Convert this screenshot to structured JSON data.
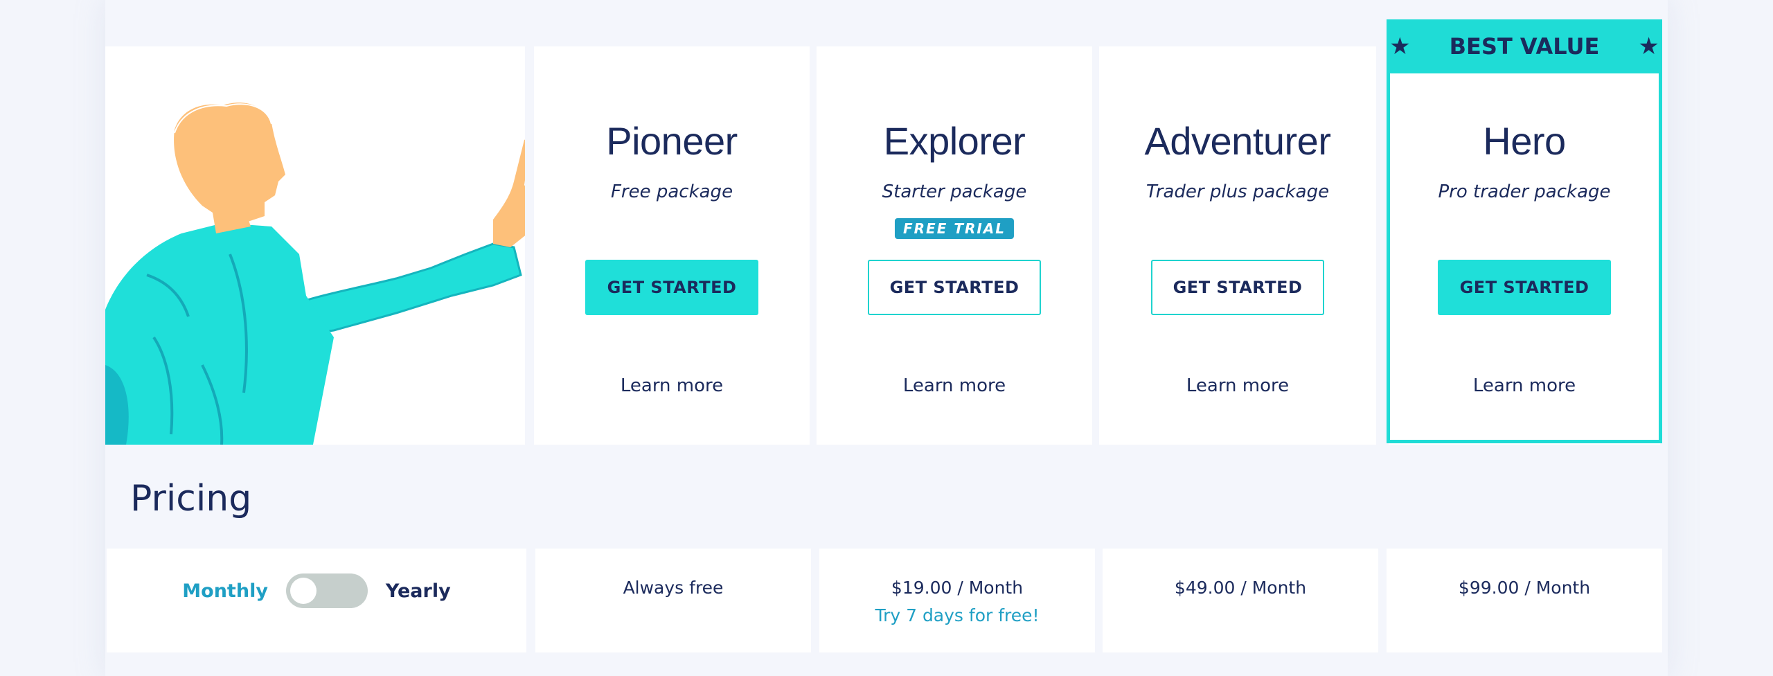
{
  "best_value": {
    "label": "BEST VALUE",
    "star_icon": "star-icon"
  },
  "plans": [
    {
      "name": "Pioneer",
      "subtitle": "Free package",
      "button": "GET STARTED",
      "learn": "Learn more"
    },
    {
      "name": "Explorer",
      "subtitle": "Starter package",
      "badge": "FREE TRIAL",
      "button": "GET STARTED",
      "learn": "Learn more"
    },
    {
      "name": "Adventurer",
      "subtitle": "Trader plus package",
      "button": "GET STARTED",
      "learn": "Learn more"
    },
    {
      "name": "Hero",
      "subtitle": "Pro trader package",
      "button": "GET STARTED",
      "learn": "Learn more"
    }
  ],
  "pricing": {
    "title": "Pricing",
    "toggle": {
      "left": "Monthly",
      "right": "Yearly",
      "selected": "Monthly"
    },
    "cells": [
      {
        "price": "Always free"
      },
      {
        "price": "$19.00 / Month",
        "note": "Try 7 days for free!"
      },
      {
        "price": "$49.00 / Month"
      },
      {
        "price": "$99.00 / Month"
      }
    ]
  },
  "colors": {
    "accent": "#1fdcd6",
    "navy": "#1b2a5c",
    "link_blue": "#1f9fc4",
    "background": "#f4f6fc"
  }
}
